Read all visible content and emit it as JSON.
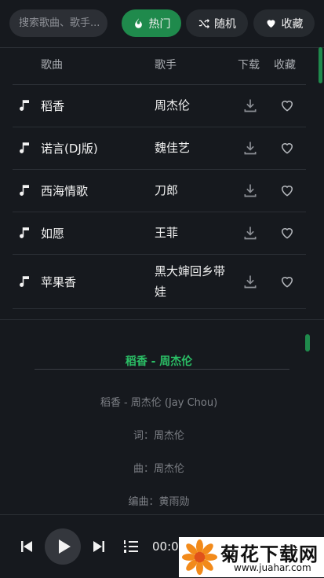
{
  "search": {
    "placeholder": "搜索歌曲、歌手..."
  },
  "tabs": [
    {
      "label": "热门",
      "active": true
    },
    {
      "label": "随机",
      "active": false
    },
    {
      "label": "收藏",
      "active": false
    }
  ],
  "table": {
    "headers": {
      "song": "歌曲",
      "artist": "歌手",
      "download": "下载",
      "favorite": "收藏"
    },
    "rows": [
      {
        "title": "稻香",
        "artist": "周杰伦"
      },
      {
        "title": "诺言(DJ版)",
        "artist": "魏佳艺"
      },
      {
        "title": "西海情歌",
        "artist": "刀郎"
      },
      {
        "title": "如愿",
        "artist": "王菲"
      },
      {
        "title": "苹果香",
        "artist": "黑大婶回乡带娃"
      }
    ]
  },
  "lyrics": {
    "now_playing": "稻香 - 周杰伦",
    "lines": [
      "稻香 - 周杰伦 (Jay Chou)",
      "词：周杰伦",
      "曲：周杰伦",
      "编曲：黄雨勋"
    ]
  },
  "player": {
    "time": "00:0"
  },
  "watermark": {
    "title": "菊花下载网",
    "url": "www.juahar.com"
  },
  "colors": {
    "accent": "#1f8a4c",
    "lyric_highlight": "#2bbf66",
    "background": "#16191e"
  }
}
